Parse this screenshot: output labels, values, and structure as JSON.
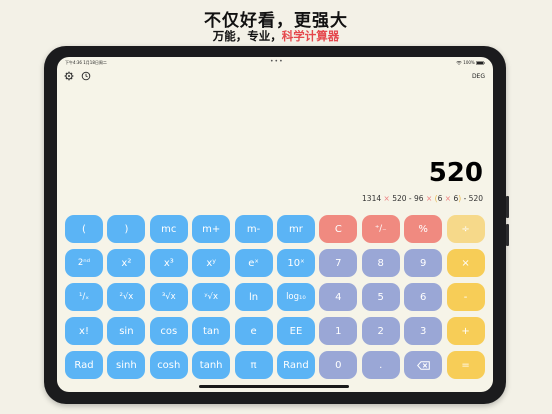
{
  "marketing": {
    "headline": "不仅好看，更强大",
    "subline_prefix": "万能，专业，",
    "subline_highlight": "科学计算器"
  },
  "status_bar": {
    "time": "下午4:36",
    "date": "1月18日周二",
    "dots": "•••",
    "battery": "100%"
  },
  "toolbar": {
    "settings_icon": "gear-icon",
    "history_icon": "clock-icon",
    "angle_mode": "DEG"
  },
  "display": {
    "result": "520",
    "expression": {
      "a": "1314",
      "op1": "×",
      "b": "520",
      "op2": "-",
      "c": "96",
      "op3": "×",
      "p1": "(",
      "d": "6",
      "op4": "×",
      "e": "6",
      "p2": ")",
      "op5": "-",
      "f": "520"
    }
  },
  "keys": {
    "r1": [
      "(",
      ")",
      "mc",
      "m+",
      "m-",
      "mr",
      "C",
      "⁺/₋",
      "%",
      "÷"
    ],
    "r2": [
      "2ⁿᵈ",
      "x²",
      "x³",
      "xʸ",
      "eˣ",
      "10ˣ",
      "7",
      "8",
      "9",
      "×"
    ],
    "r3": [
      "¹/ₓ",
      "²√x",
      "³√x",
      "ʸ√x",
      "ln",
      "log₁₀",
      "4",
      "5",
      "6",
      "-"
    ],
    "r4": [
      "x!",
      "sin",
      "cos",
      "tan",
      "e",
      "EE",
      "1",
      "2",
      "3",
      "+"
    ],
    "r5": [
      "Rad",
      "sinh",
      "cosh",
      "tanh",
      "π",
      "Rand",
      "0",
      ".",
      "⌫",
      "="
    ]
  },
  "colors": {
    "function_key": "#5bb4f5",
    "clear_key": "#f08a80",
    "digit_key": "#9aa7d6",
    "operator_key": "#f7cd57",
    "accent_text": "#e5484d"
  }
}
